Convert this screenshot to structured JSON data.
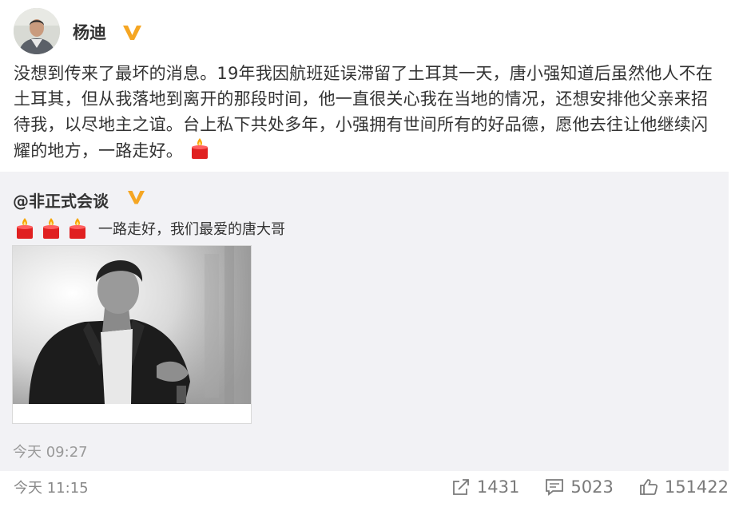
{
  "post": {
    "author": "杨迪",
    "text": "没想到传来了最坏的消息。19年我因航班延误滞留了土耳其一天，唐小强知道后虽然他人不在土耳其，但从我落地到离开的那段时间，他一直很关心我在当地的情况，还想安排他父亲来招待我，以尽地主之谊。台上私下共处多年，小强拥有世间所有的好品德，愿他去往让他继续闪耀的地方，一路走好。",
    "time": "今天 11:15"
  },
  "repost": {
    "author": "@非正式会谈",
    "text": "一路走好，我们最爱的唐大哥",
    "time": "今天 09:27"
  },
  "stats": {
    "reposts": "1431",
    "comments": "5023",
    "likes": "151422"
  },
  "colors": {
    "verified_badge": "#f5a623",
    "candle_red": "#e02020",
    "repost_bg": "#f2f2f5"
  },
  "icons": [
    "verified-badge-icon",
    "candle-icon",
    "share-icon",
    "comment-icon",
    "like-icon"
  ]
}
